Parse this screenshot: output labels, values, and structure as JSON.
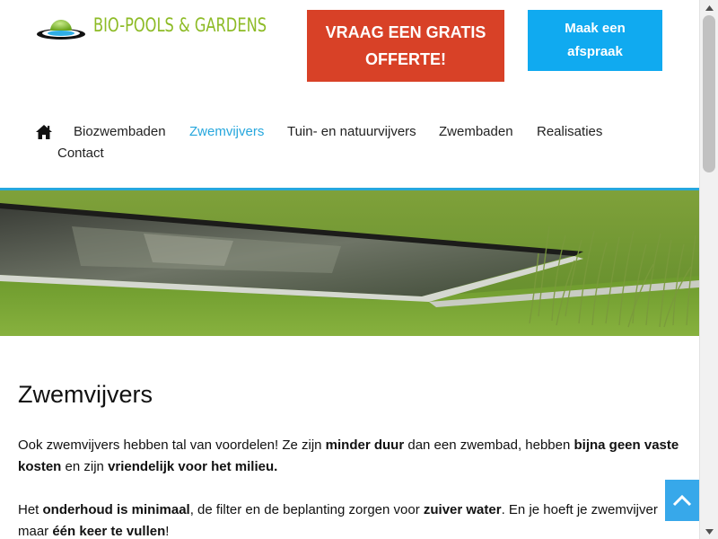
{
  "header": {
    "logo_text": "BIO-POOLS & GARDENS",
    "cta_quote_label": "VRAAG EEN GRATIS OFFERTE!",
    "cta_appointment_label": "Maak een afspraak"
  },
  "nav": {
    "home_icon": "home-icon",
    "items": [
      {
        "label": "Biozwembaden"
      },
      {
        "label": "Zwemvijvers",
        "active": true
      },
      {
        "label": "Tuin- en natuurvijvers"
      },
      {
        "label": "Zwembaden"
      },
      {
        "label": "Realisaties"
      },
      {
        "label": "Contact"
      }
    ]
  },
  "main": {
    "title": "Zwemvijvers",
    "p1": {
      "a": "Ook zwemvijvers hebben tal van voordelen! Ze zijn ",
      "b": "minder duur",
      "c": " dan een zwembad, hebben ",
      "d": "bijna geen vaste kosten",
      "e": " en zijn ",
      "f": "vriendelijk voor het milieu."
    },
    "p2": {
      "a": "Het ",
      "b": "onderhoud is minimaal",
      "c": ", de filter en de beplanting zorgen voor ",
      "d": "zuiver water",
      "e": ". En je hoeft je zwemvijver maar ",
      "f": "één keer te vullen",
      "g": "!"
    }
  },
  "colors": {
    "brand_green": "#8dbb26",
    "quote_red": "#d84127",
    "appointment_blue": "#10aaf0",
    "accent_blue": "#26a7dd"
  },
  "icons": {
    "scroll_top": "chevron-up-icon"
  }
}
